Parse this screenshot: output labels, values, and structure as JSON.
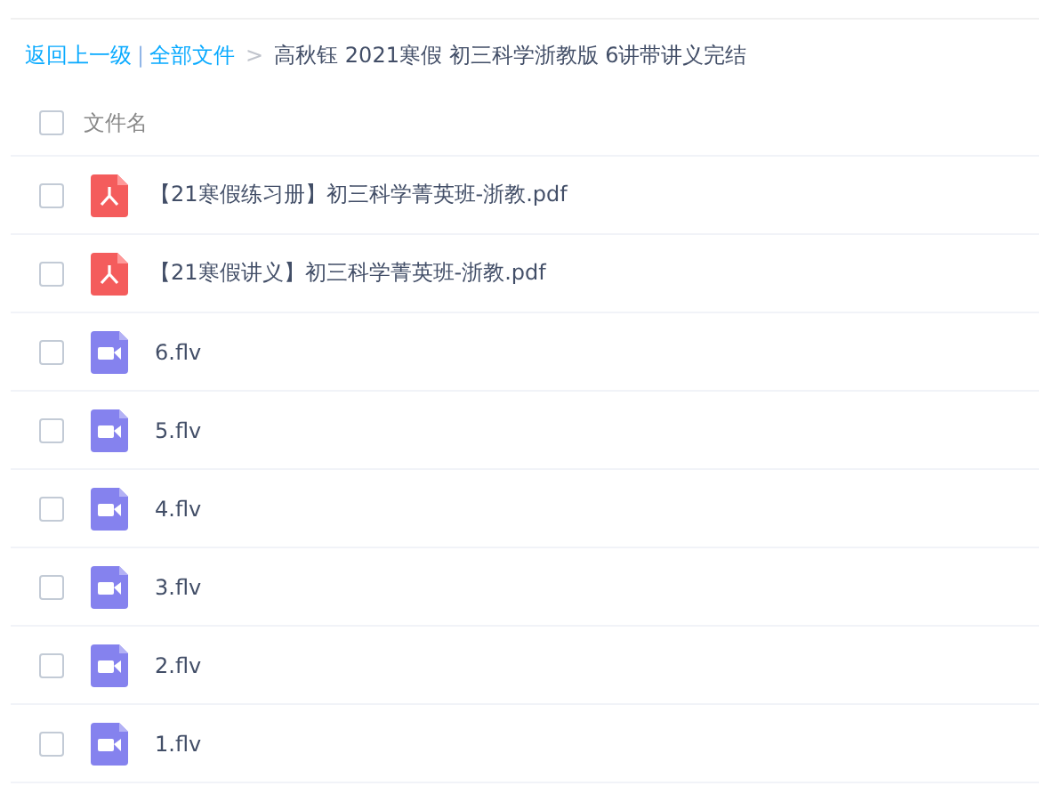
{
  "breadcrumb": {
    "back": "返回上一级",
    "separator": "|",
    "root": "全部文件",
    "arrow": ">",
    "current": "高秋钰 2021寒假 初三科学浙教版 6讲带讲义完结"
  },
  "header": {
    "checked": false,
    "label": "文件名"
  },
  "files": [
    {
      "kind": "pdf",
      "name": "【21寒假练习册】初三科学菁英班-浙教.pdf",
      "checked": false
    },
    {
      "kind": "pdf",
      "name": "【21寒假讲义】初三科学菁英班-浙教.pdf",
      "checked": false
    },
    {
      "kind": "video",
      "name": "6.flv",
      "checked": false
    },
    {
      "kind": "video",
      "name": "5.flv",
      "checked": false
    },
    {
      "kind": "video",
      "name": "4.flv",
      "checked": false
    },
    {
      "kind": "video",
      "name": "3.flv",
      "checked": false
    },
    {
      "kind": "video",
      "name": "2.flv",
      "checked": false
    },
    {
      "kind": "video",
      "name": "1.flv",
      "checked": false
    }
  ]
}
